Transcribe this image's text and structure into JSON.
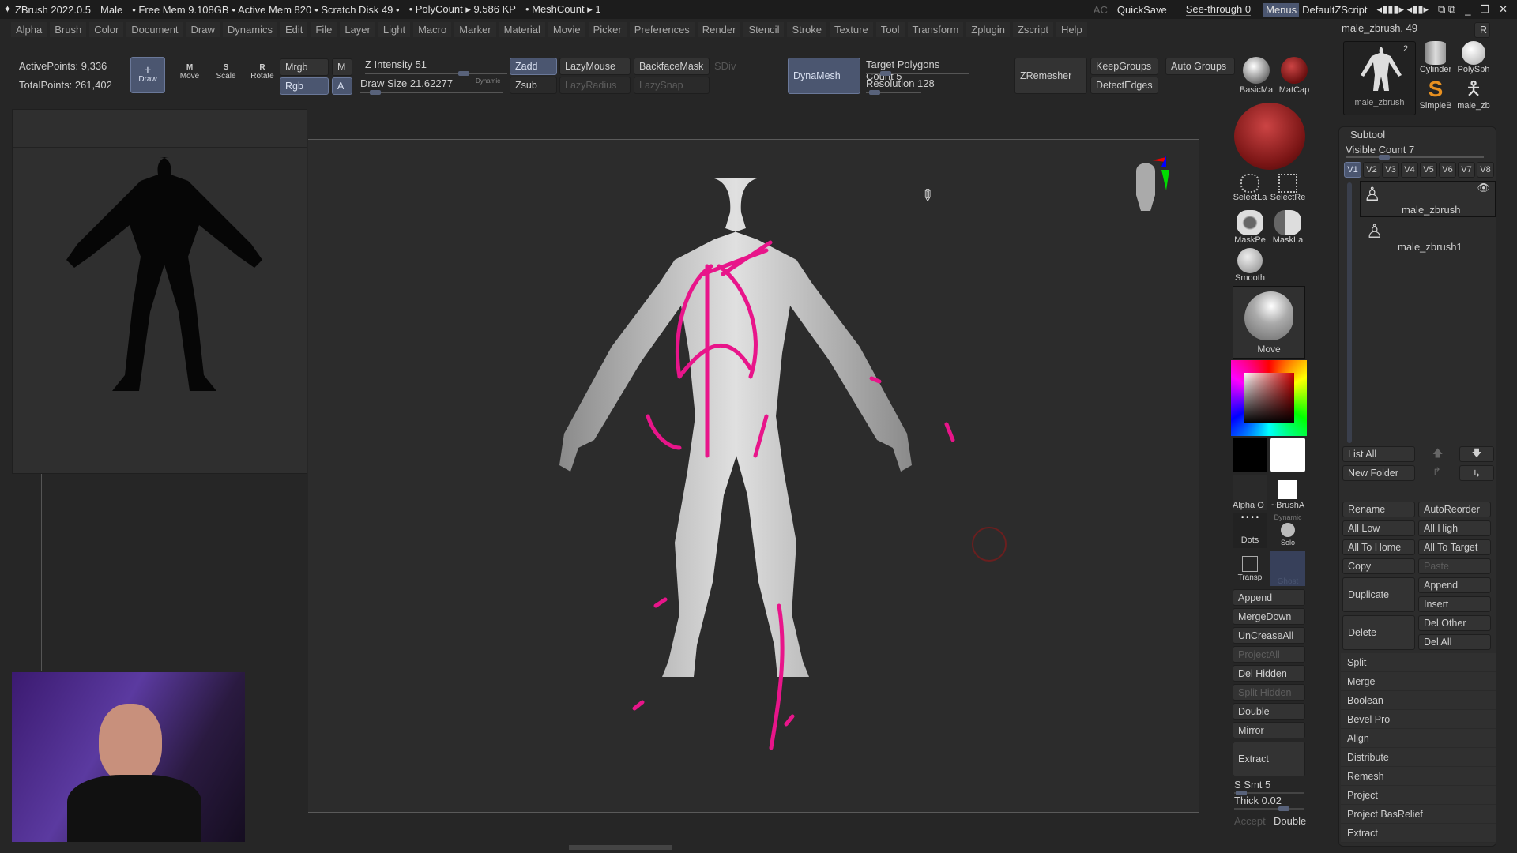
{
  "titlebar": {
    "app": "ZBrush 2022.0.5",
    "doc": "Male",
    "free_mem": "• Free Mem 9.108GB",
    "active_mem": "• Active Mem 820",
    "scratch": "• Scratch Disk 49 •",
    "polycount": "• PolyCount ▸ 9.586 KP",
    "meshcount": "• MeshCount ▸ 1",
    "ac": "AC",
    "quicksave": "QuickSave",
    "seethrough": "See-through  0",
    "menus": "Menus",
    "script": "DefaultZScript"
  },
  "menus": [
    "Alpha",
    "Brush",
    "Color",
    "Document",
    "Draw",
    "Dynamics",
    "Edit",
    "File",
    "Layer",
    "Light",
    "Macro",
    "Marker",
    "Material",
    "Movie",
    "Picker",
    "Preferences",
    "Render",
    "Stencil",
    "Stroke",
    "Texture",
    "Tool",
    "Transform",
    "Zplugin",
    "Zscript",
    "Help"
  ],
  "shelf": {
    "active_points": "ActivePoints: 9,336",
    "total_points": "TotalPoints: 261,402",
    "draw": "Draw",
    "move": "Move",
    "scale": "Scale",
    "rotate": "Rotate",
    "mrgb": "Mrgb",
    "rgb": "Rgb",
    "m": "M",
    "a": "A",
    "z_intensity": "Z Intensity 51",
    "draw_size": "Draw Size 21.62277",
    "dynamic": "Dynamic",
    "zadd": "Zadd",
    "zsub": "Zsub",
    "lazymouse": "LazyMouse",
    "lazyradius": "LazyRadius",
    "backfacemask": "BackfaceMask",
    "lazysnap": "LazySnap",
    "sdiv": "SDiv",
    "dynamesh": "DynaMesh",
    "target_polys": "Target Polygons Count 5",
    "resolution": "Resolution 128",
    "zremesher": "ZRemesher",
    "keepgroups": "KeepGroups",
    "detectedges": "DetectEdges",
    "autogroups": "Auto Groups",
    "basicmat": "BasicMa",
    "matcap": "MatCap"
  },
  "tool_palette": {
    "current": "male_zbrush. 49",
    "r": "R",
    "thumbs": [
      "male_zbrush",
      "Cylinder",
      "PolySph",
      "SimpleB",
      "male_zb"
    ],
    "count": "2"
  },
  "tools": {
    "select_lasso": "SelectLa",
    "select_rect": "SelectRe",
    "mask_pen": "MaskPe",
    "mask_lasso": "MaskLa",
    "smooth": "Smooth",
    "brush": "Move",
    "alpha": "Alpha O",
    "brush_alpha": "~BrushA",
    "dots": "Dots",
    "dynamic": "Dynamic",
    "solo": "Solo",
    "transp": "Transp",
    "ghost": "Ghost",
    "buttons": [
      {
        "label": "Append",
        "dim": false
      },
      {
        "label": "MergeDown",
        "dim": false
      },
      {
        "label": "UnCreaseAll",
        "dim": false
      },
      {
        "label": "ProjectAll",
        "dim": true
      },
      {
        "label": "Del Hidden",
        "dim": false
      },
      {
        "label": "Split Hidden",
        "dim": true
      },
      {
        "label": "Double",
        "dim": false
      },
      {
        "label": "Mirror",
        "dim": false
      }
    ],
    "extract": "Extract",
    "s_smt": "S Smt 5",
    "thick": "Thick 0.02",
    "accept": "Accept",
    "double": "Double"
  },
  "subtool": {
    "title": "Subtool",
    "visible_count": "Visible Count 7",
    "versions": [
      "V1",
      "V2",
      "V3",
      "V4",
      "V5",
      "V6",
      "V7",
      "V8"
    ],
    "items": [
      "male_zbrush",
      "male_zbrush1"
    ],
    "list_all": "List All",
    "new_folder": "New Folder",
    "grid": [
      [
        "Rename",
        "AutoReorder"
      ],
      [
        "All Low",
        "All High"
      ],
      [
        "All To Home",
        "All To Target"
      ],
      [
        "Copy",
        "Paste"
      ]
    ],
    "duplicate": "Duplicate",
    "append": "Append",
    "insert": "Insert",
    "delete": "Delete",
    "del_other": "Del Other",
    "del_all": "Del All",
    "list": [
      "Split",
      "Merge",
      "Boolean",
      "Bevel Pro",
      "Align",
      "Distribute",
      "Remesh",
      "Project",
      "Project BasRelief",
      "Extract"
    ]
  },
  "colors": {
    "accent": "#4b5670",
    "stroke": "#e8158a",
    "mesh": "#bdbdbd"
  }
}
